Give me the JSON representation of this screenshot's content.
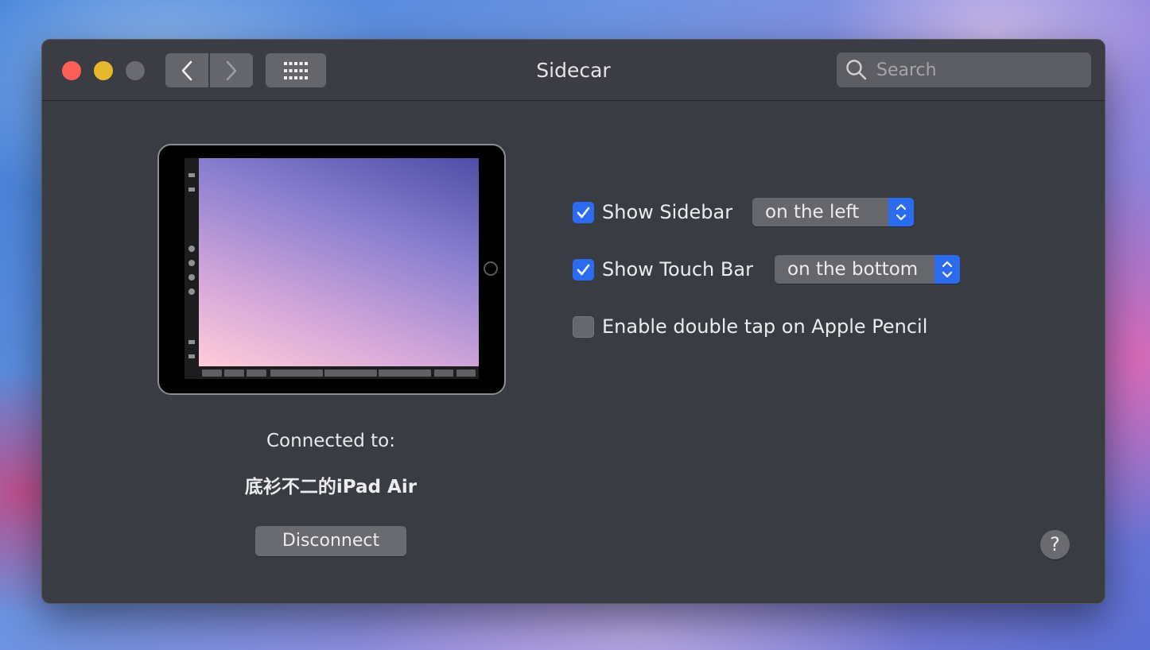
{
  "window": {
    "title": "Sidecar"
  },
  "toolbar": {
    "back_icon": "chevron-left-icon",
    "forward_icon": "chevron-right-icon",
    "grid_icon": "show-all-grid-icon"
  },
  "search": {
    "placeholder": "Search",
    "value": "",
    "icon": "search-icon"
  },
  "connection": {
    "label": "Connected to:",
    "device_name": "底衫不二的iPad Air",
    "disconnect_label": "Disconnect"
  },
  "options": [
    {
      "label": "Show Sidebar",
      "checked": true,
      "popup_value": "on the left"
    },
    {
      "label": "Show Touch Bar",
      "checked": true,
      "popup_value": "on the bottom"
    },
    {
      "label": "Enable double tap on Apple Pencil",
      "checked": false
    }
  ],
  "help": {
    "label": "?"
  },
  "colors": {
    "accent": "#2b6bf0",
    "window_bg": "#3a3c43",
    "close": "#fe5f57",
    "minimize": "#e6b82d",
    "zoom_disabled": "#6a6b70"
  }
}
